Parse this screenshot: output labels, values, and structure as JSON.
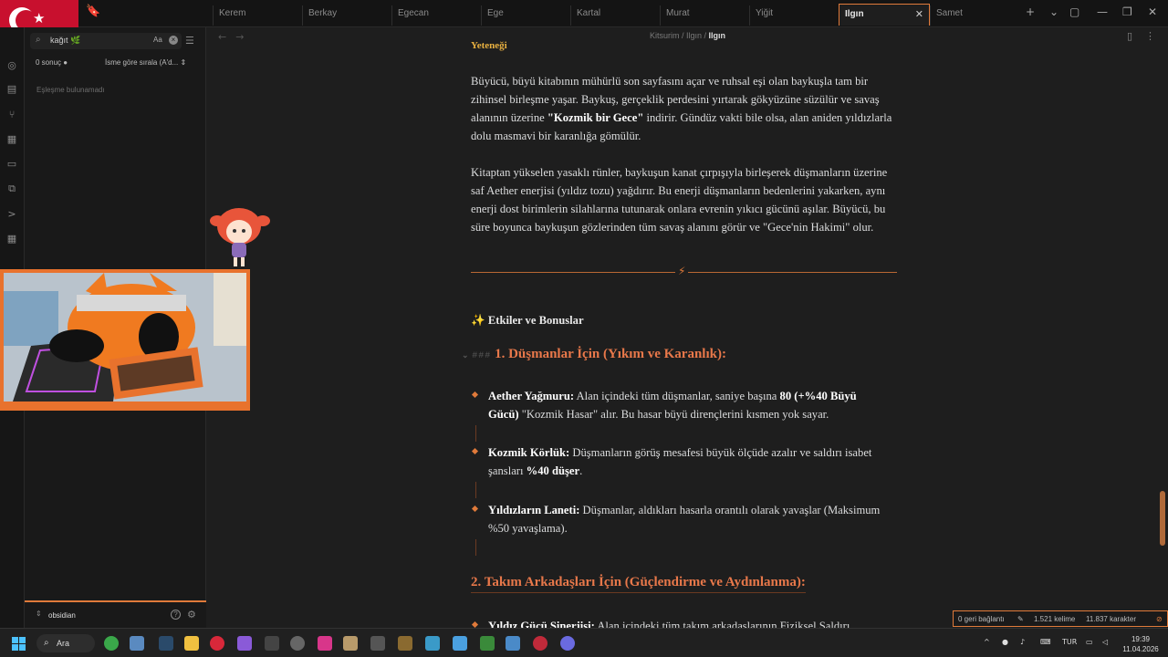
{
  "tabs": [
    {
      "label": "Kerem",
      "active": false
    },
    {
      "label": "Berkay",
      "active": false
    },
    {
      "label": "Egecan",
      "active": false
    },
    {
      "label": "Ege",
      "active": false
    },
    {
      "label": "Kartal",
      "active": false
    },
    {
      "label": "Murat",
      "active": false
    },
    {
      "label": "Yiğit",
      "active": false
    },
    {
      "label": "Ilgın",
      "active": true
    },
    {
      "label": "Samet",
      "active": false
    }
  ],
  "tab_close": "✕",
  "search": {
    "query": "kağıt 🌿",
    "case_label": "Aa",
    "result_count": "0 sonuç",
    "sort_label": "İsme göre sırala (A'd...",
    "no_match": "Eşleşme bulunamadı"
  },
  "vault": {
    "name": "obsidian"
  },
  "breadcrumb": {
    "root": "Kitsurim",
    "mid": "Ilgın",
    "current": "Ilgın"
  },
  "note": {
    "heading_partial": "Yeteneği",
    "p1_before": "Büyücü, büyü kitabının mühürlü son sayfasını açar ve ruhsal eşi olan baykuşla tam bir zihinsel birleşme yaşar. Baykuş, gerçeklik perdesini yırtarak gökyüzüne süzülür ve savaş alanının üzerine ",
    "p1_bold": "\"Kozmik bir Gece\"",
    "p1_after": " indirir. Gündüz vakti bile olsa, alan aniden yıldızlarla dolu masmavi bir karanlığa gömülür.",
    "p2": "Kitaptan yükselen yasaklı rünler, baykuşun kanat çırpışıyla birleşerek düşmanların üzerine saf Aether enerjisi (yıldız tozu) yağdırır. Bu enerji düşmanların bedenlerini yakarken, aynı enerji dost birimlerin silahlarına tutunarak onlara evrenin yıkıcı gücünü aşılar. Büyücü, bu süre boyunca baykuşun gözlerinden tüm savaş alanını görür ve \"Gece'nin Hakimi\" olur.",
    "divider_icon": "⚡",
    "effects_icon": "✨",
    "effects_heading": "Etkiler ve Bonuslar",
    "h3_markup": "###",
    "h3_1": "1. Düşmanlar İçin (Yıkım ve Karanlık):",
    "b1_label": "Aether Yağmuru:",
    "b1_text": " Alan içindeki tüm düşmanlar, saniye başına ",
    "b1_bold": "80 (+%40 Büyü Gücü)",
    "b1_after": " \"Kozmik Hasar\" alır. Bu hasar büyü dirençlerini kısmen yok sayar.",
    "b2_label": "Kozmik Körlük:",
    "b2_text": " Düşmanların görüş mesafesi büyük ölçüde azalır ve saldırı isabet şansları ",
    "b2_bold": "%40 düşer",
    "b2_after": ".",
    "b3_label": "Yıldızların Laneti:",
    "b3_text": " Düşmanlar, aldıkları hasarla orantılı olarak yavaşlar (Maksimum %50 yavaşlama).",
    "h2_2": "2. Takım Arkadaşları İçin (Güçlendirme ve Aydınlanma):",
    "b4_label": "Yıldız Gücü Sinerjisi:",
    "b4_text": " Alan içindeki tüm takım arkadaşlarının Fiziksel Saldırı"
  },
  "status": {
    "backlinks": "0 geri bağlantı",
    "words": "1.521 kelime",
    "chars": "11.837 karakter"
  },
  "taskbar": {
    "search_label": "Ara",
    "lang": "TUR",
    "time": "19:39",
    "date": "11.04.2026"
  },
  "colors": {
    "accent": "#e07a3a",
    "heading": "#e8784a",
    "background": "#1e1e1e"
  }
}
